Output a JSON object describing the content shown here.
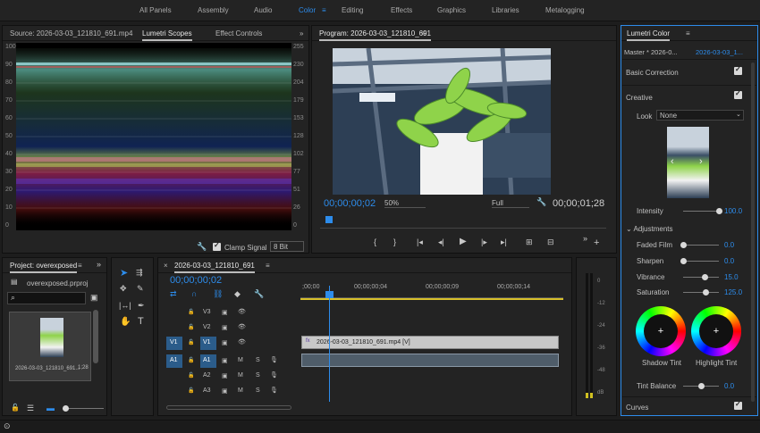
{
  "nav": [
    "All Panels",
    "Assembly",
    "Audio",
    "Color",
    "Editing",
    "Effects",
    "Graphics",
    "Libraries",
    "Metalogging"
  ],
  "nav_active_index": 3,
  "source_panel": {
    "tabs": [
      "Source: 2026-03-03_121810_691.mp4",
      "Lumetri Scopes",
      "Effect Controls"
    ],
    "left_ticks": [
      "100",
      "90",
      "80",
      "70",
      "60",
      "50",
      "40",
      "30",
      "20",
      "10",
      "0"
    ],
    "right_ticks": [
      "255",
      "230",
      "204",
      "179",
      "153",
      "128",
      "102",
      "77",
      "51",
      "26",
      "0"
    ],
    "clamp_label": "Clamp Signal",
    "bit_depth": "8 Bit"
  },
  "program": {
    "title": "Program: 2026-03-03_121810_691",
    "timecode_current": "00;00;00;02",
    "zoom": "50%",
    "resolution": "Full",
    "timecode_duration": "00;00;01;28"
  },
  "project": {
    "title": "Project: overexposed",
    "file": "overexposed.prproj",
    "clip_name": "2026-03-03_121810_691...",
    "clip_duration": "1;28"
  },
  "timeline": {
    "title": "2026-03-03_121810_691",
    "timecode": "00;00;00;02",
    "ruler": [
      ";00;00",
      "00;00;00;04",
      "00;00;00;09",
      "00;00;00;14"
    ],
    "tracks": [
      {
        "src": "",
        "lock": "🔒",
        "name": "V3"
      },
      {
        "src": "",
        "lock": "🔒",
        "name": "V2"
      },
      {
        "src": "V1",
        "lock": "🔒",
        "name": "V1"
      },
      {
        "src": "A1",
        "lock": "🔒",
        "name": "A1"
      },
      {
        "src": "",
        "lock": "🔒",
        "name": "A2"
      },
      {
        "src": "",
        "lock": "🔒",
        "name": "A3"
      }
    ],
    "video_clip": "2026-03-03_121810_691.mp4 [V]",
    "mute": "M",
    "solo": "S"
  },
  "meter_ticks": [
    "0",
    "-12",
    "-24",
    "-36",
    "-48",
    "dB"
  ],
  "lumetri": {
    "title": "Lumetri Color",
    "master": "Master * 2026-0...",
    "clip": "2026-03-03_1...",
    "basic_correction": "Basic Correction",
    "creative": "Creative",
    "look_label": "Look",
    "look_value": "None",
    "intensity_label": "Intensity",
    "intensity_value": "100.0",
    "adjustments": "Adjustments",
    "faded_film_label": "Faded Film",
    "faded_film_value": "0.0",
    "sharpen_label": "Sharpen",
    "sharpen_value": "0.0",
    "vibrance_label": "Vibrance",
    "vibrance_value": "15.0",
    "saturation_label": "Saturation",
    "saturation_value": "125.0",
    "shadow_tint": "Shadow Tint",
    "highlight_tint": "Highlight Tint",
    "tint_balance_label": "Tint Balance",
    "tint_balance_value": "0.0",
    "curves": "Curves",
    "sliders": {
      "intensity": 1.0,
      "faded_film": 0.0,
      "sharpen": 0.0,
      "vibrance": 0.6,
      "saturation": 0.62,
      "tint_balance": 0.5
    }
  },
  "colors": {
    "accent": "#2d8ceb",
    "panel": "#232323",
    "clip_video": "#c8c8c8"
  }
}
